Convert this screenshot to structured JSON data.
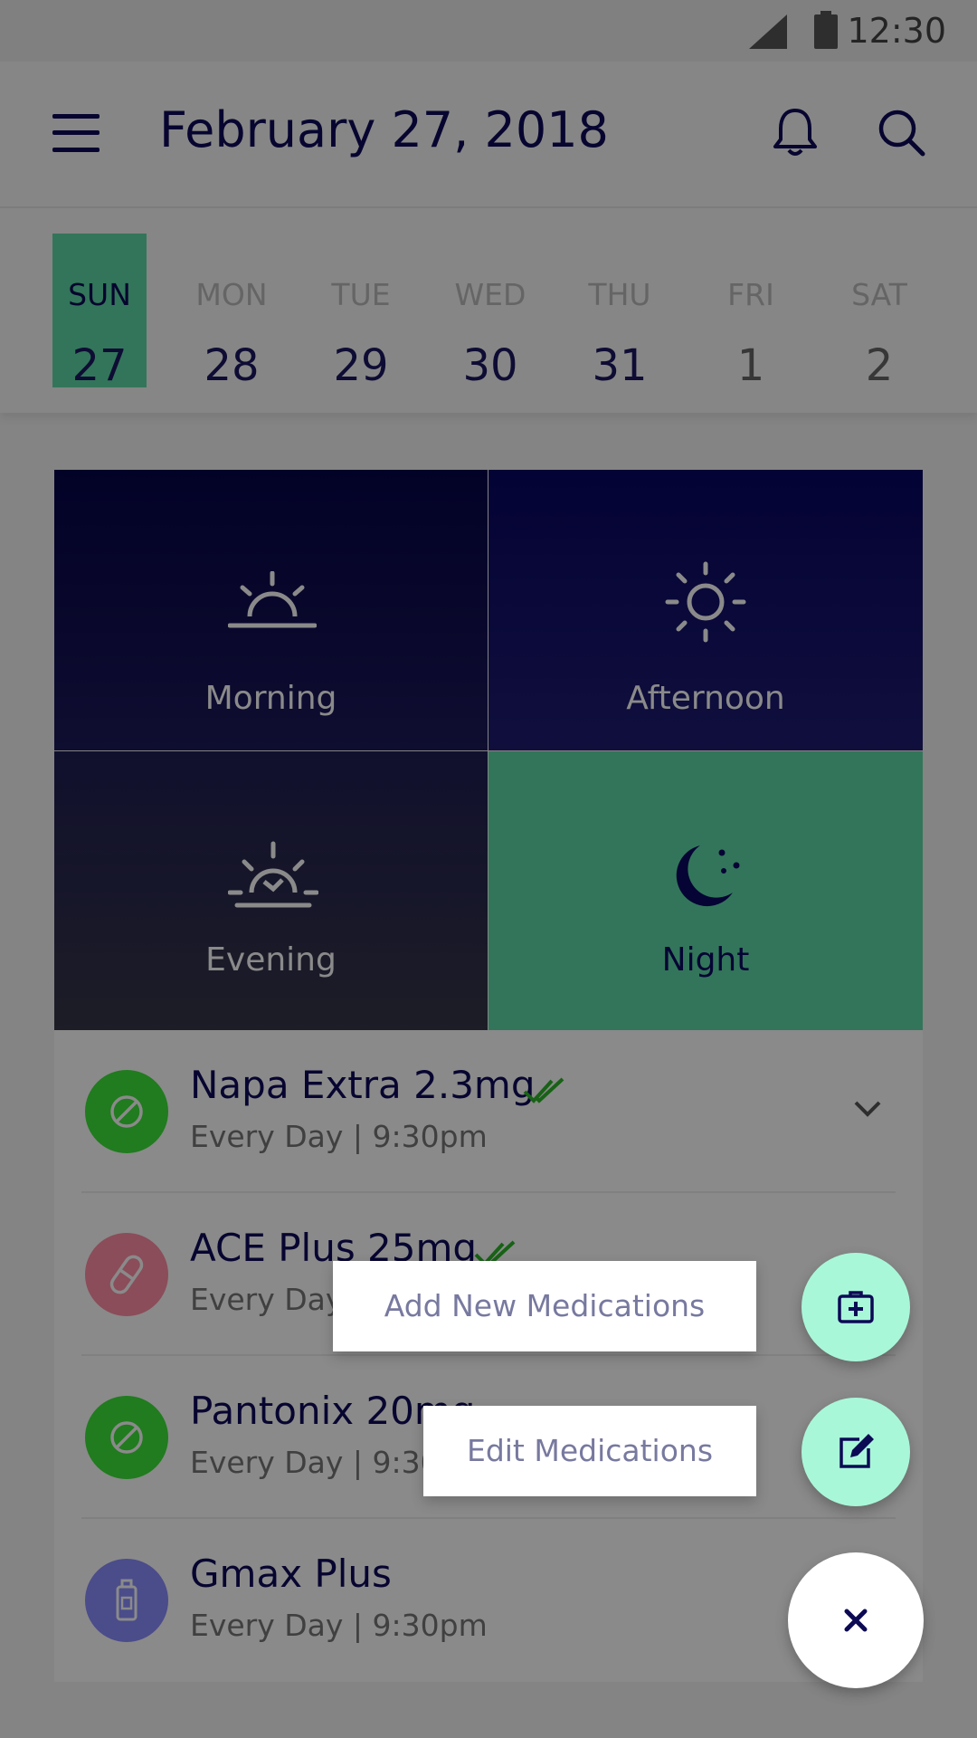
{
  "status_bar": {
    "time": "12:30"
  },
  "app_bar": {
    "title": "February 27, 2018"
  },
  "week": [
    {
      "day": "SUN",
      "date": "27",
      "selected": true
    },
    {
      "day": "MON",
      "date": "28"
    },
    {
      "day": "TUE",
      "date": "29"
    },
    {
      "day": "WED",
      "date": "30"
    },
    {
      "day": "THU",
      "date": "31"
    },
    {
      "day": "FRI",
      "date": "1"
    },
    {
      "day": "SAT",
      "date": "2"
    }
  ],
  "time_of_day": {
    "morning": "Morning",
    "afternoon": "Afternoon",
    "evening": "Evening",
    "night": "Night"
  },
  "medications": [
    {
      "name": "Napa Extra 2.3mg",
      "schedule": "Every Day | 9:30pm",
      "icon": "no-entry-icon",
      "color": "#3ee43a"
    },
    {
      "name": "ACE Plus 25mg",
      "schedule": "Every Day | 9:30pm",
      "icon": "capsule-icon",
      "color": "#ff8fa4"
    },
    {
      "name": "Pantonix 20mg",
      "schedule": "Every Day | 9:30pm",
      "icon": "no-entry-icon",
      "color": "#3ee43a"
    },
    {
      "name": "Gmax Plus",
      "schedule": "Every Day | 9:30pm",
      "icon": "bottle-icon",
      "color": "#8b8cff"
    }
  ],
  "speed_dial": {
    "add_label": "Add New Medications",
    "edit_label": "Edit Medications"
  },
  "colors": {
    "accent": "#5fd9a6",
    "navy": "#0e0b59",
    "fab_mint": "#a9f7d9"
  }
}
